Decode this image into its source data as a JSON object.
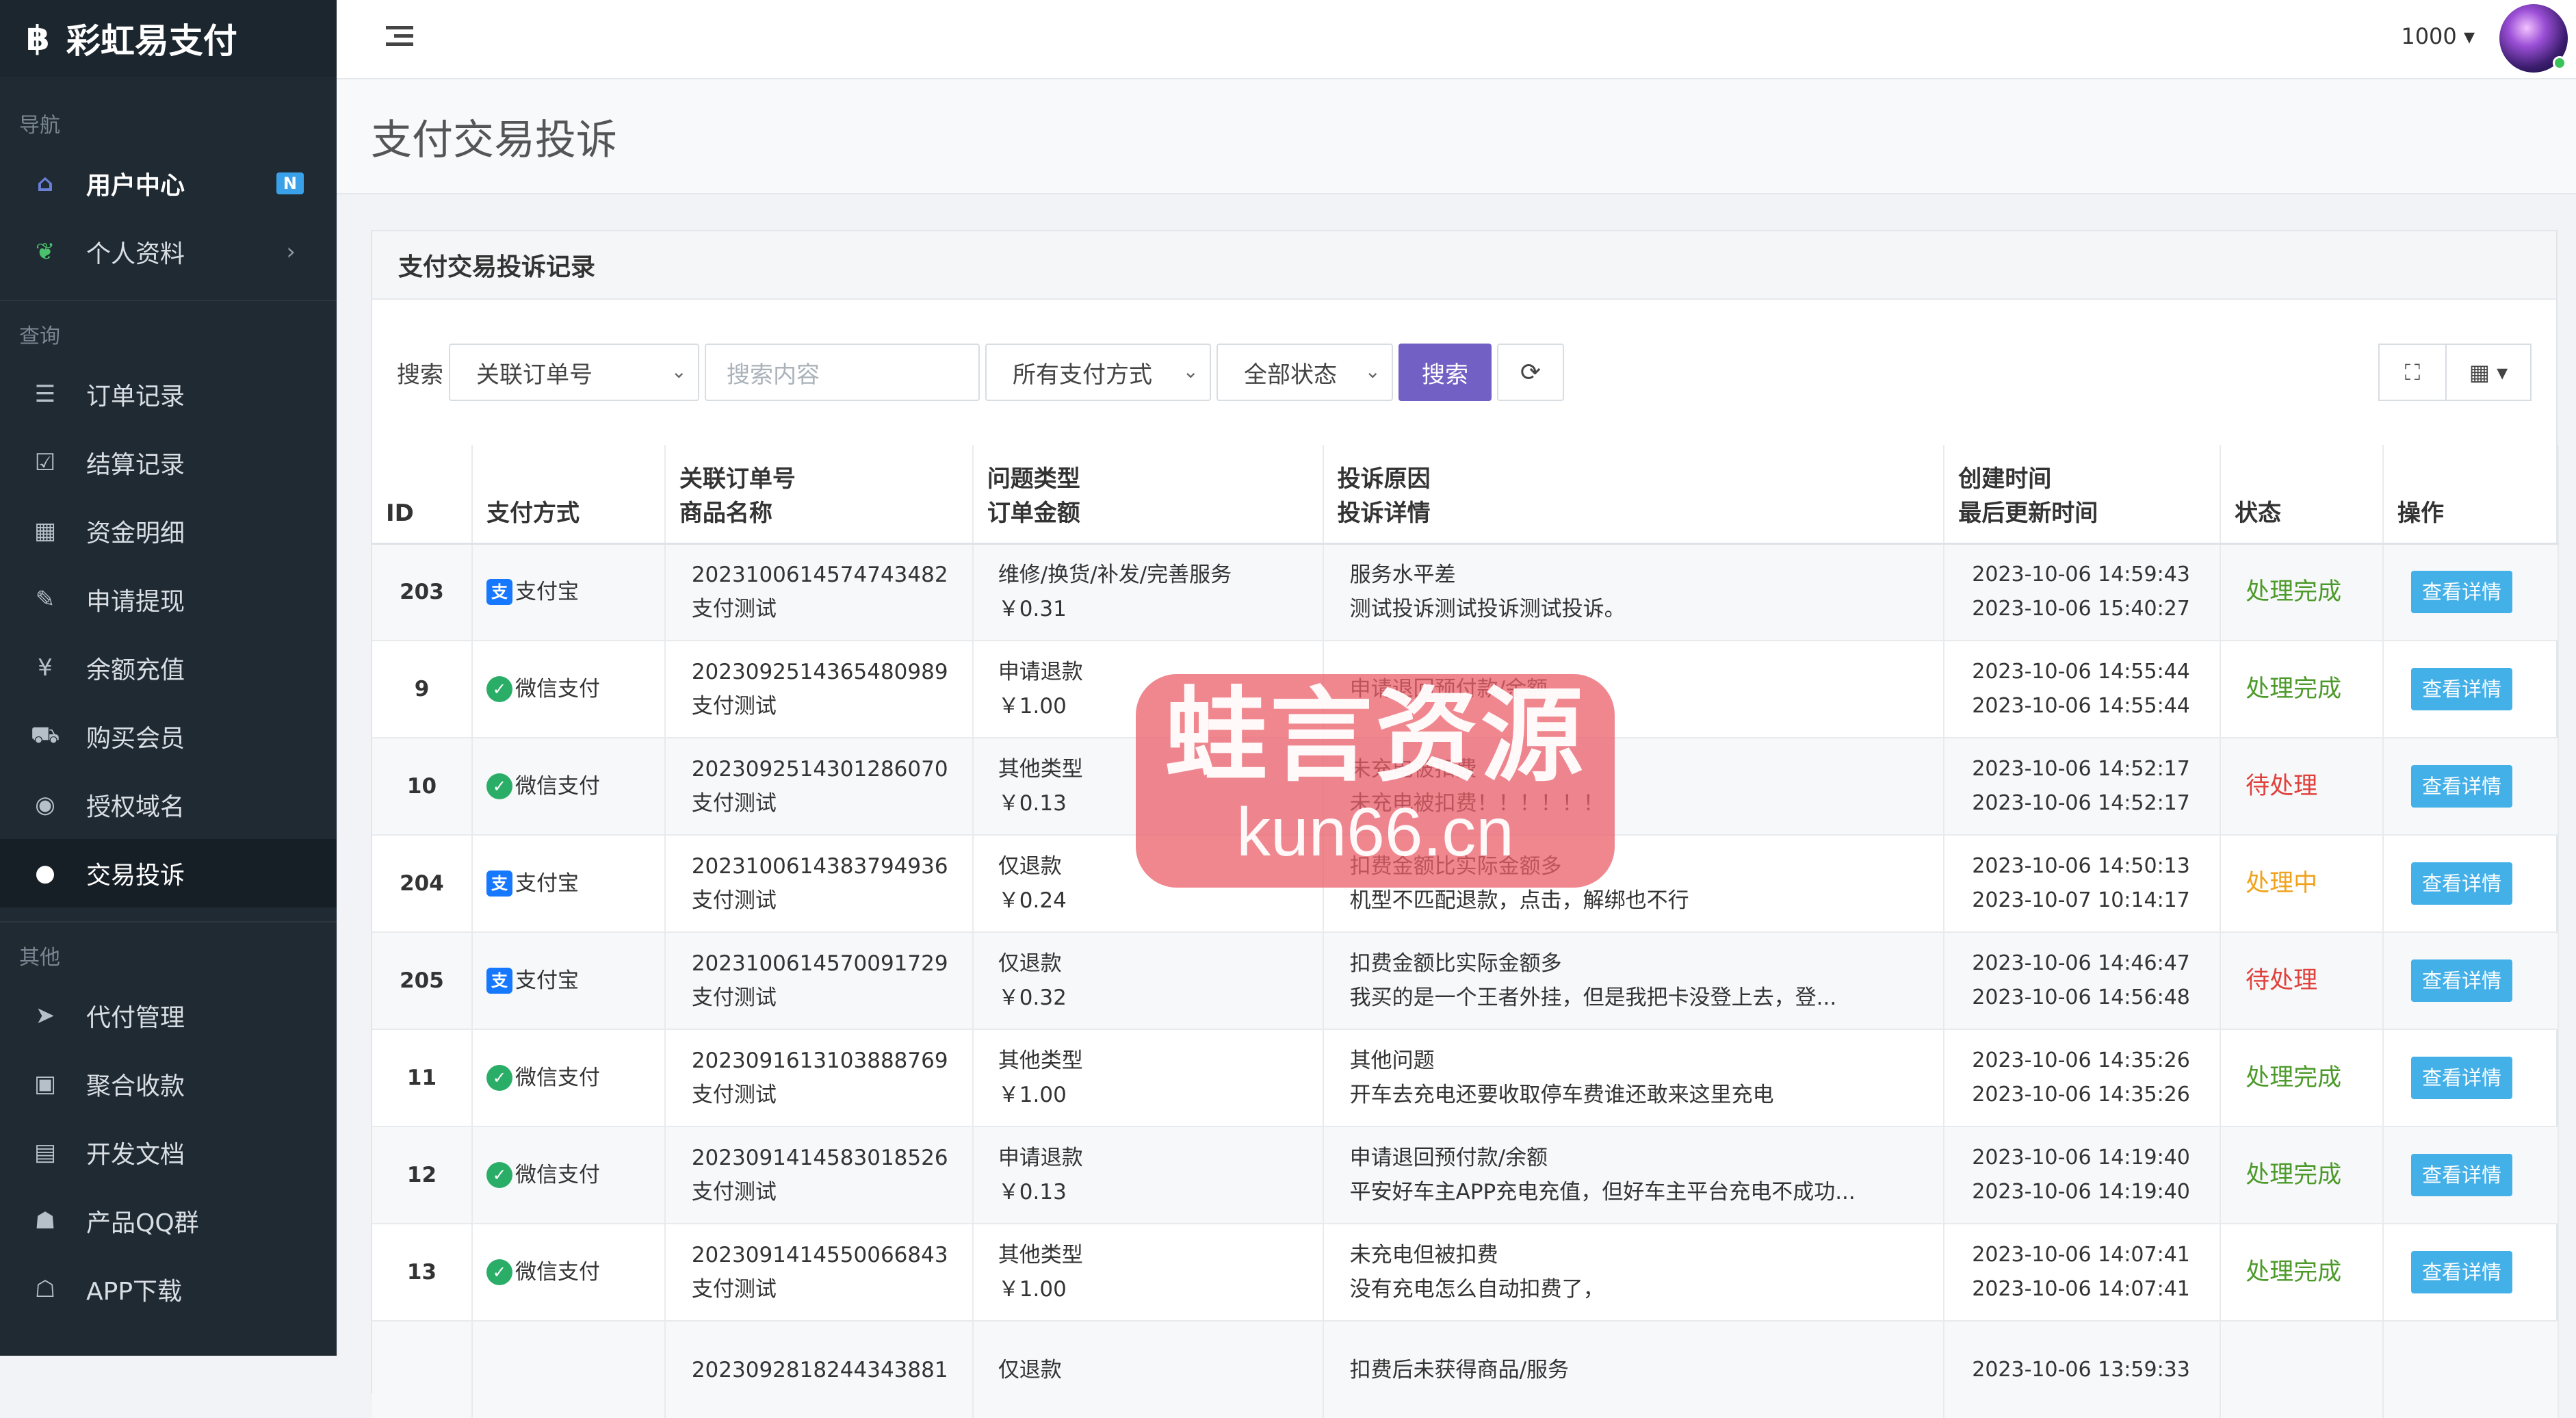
{
  "brand": {
    "logo_glyph": "฿",
    "name": "彩虹易支付"
  },
  "sidebar": {
    "sections": [
      {
        "title": "导航",
        "items": [
          {
            "label": "用户中心",
            "icon": "home-icon",
            "badge": "N"
          },
          {
            "label": "个人资料",
            "icon": "leaf-icon",
            "caret": "›"
          }
        ]
      },
      {
        "title": "查询",
        "items": [
          {
            "label": "订单记录",
            "icon": "list-icon"
          },
          {
            "label": "结算记录",
            "icon": "check-square-icon"
          },
          {
            "label": "资金明细",
            "icon": "calendar-icon"
          },
          {
            "label": "申请提现",
            "icon": "edit-icon"
          },
          {
            "label": "余额充值",
            "icon": "yen-icon"
          },
          {
            "label": "购买会员",
            "icon": "cart-icon"
          },
          {
            "label": "授权域名",
            "icon": "globe-icon"
          },
          {
            "label": "交易投诉",
            "icon": "chat-icon"
          }
        ]
      },
      {
        "title": "其他",
        "items": [
          {
            "label": "代付管理",
            "icon": "send-icon"
          },
          {
            "label": "聚合收款",
            "icon": "qrcode-icon"
          },
          {
            "label": "开发文档",
            "icon": "document-icon"
          },
          {
            "label": "产品QQ群",
            "icon": "qq-icon"
          },
          {
            "label": "APP下载",
            "icon": "android-icon"
          }
        ]
      }
    ]
  },
  "topbar": {
    "user": "1000",
    "caret": "▾"
  },
  "page": {
    "title": "支付交易投诉"
  },
  "panel": {
    "title": "支付交易投诉记录"
  },
  "search": {
    "label": "搜索",
    "field_select": "关联订单号",
    "placeholder": "搜索内容",
    "pay_select": "所有支付方式",
    "status_select": "全部状态",
    "search_button": "搜索",
    "refresh_glyph": "⟳",
    "fullscreen_glyph": "⛶",
    "columns_glyph": "▦ ▾"
  },
  "table": {
    "headers": {
      "id": "ID",
      "paytype": "支付方式",
      "order_1": "关联订单号",
      "order_2": "商品名称",
      "type_1": "问题类型",
      "type_2": "订单金额",
      "reason_1": "投诉原因",
      "reason_2": "投诉详情",
      "time_1": "创建时间",
      "time_2": "最后更新时间",
      "status": "状态",
      "action": "操作"
    },
    "rows": [
      {
        "id": "203",
        "pay": "支付宝",
        "pay_type": "alipay",
        "order": "2023100614574743482",
        "product": "支付测试",
        "type": "维修/换货/补发/完善服务",
        "amount": "￥0.31",
        "reason": "服务水平差",
        "detail": "测试投诉测试投诉测试投诉。",
        "created": "2023-10-06 14:59:43",
        "updated": "2023-10-06 15:40:27",
        "status": "处理完成",
        "status_color": "#4c9a2a",
        "action": "查看详情"
      },
      {
        "id": "9",
        "pay": "微信支付",
        "pay_type": "wechat",
        "order": "2023092514365480989",
        "product": "支付测试",
        "type": "申请退款",
        "amount": "￥1.00",
        "reason": "申请退回预付款/余额",
        "detail": "",
        "created": "2023-10-06 14:55:44",
        "updated": "2023-10-06 14:55:44",
        "status": "处理完成",
        "status_color": "#4c9a2a",
        "action": "查看详情"
      },
      {
        "id": "10",
        "pay": "微信支付",
        "pay_type": "wechat",
        "order": "2023092514301286070",
        "product": "支付测试",
        "type": "其他类型",
        "amount": "￥0.13",
        "reason": "未充电被扣费",
        "detail": "未充电被扣费！！！！！！",
        "created": "2023-10-06 14:52:17",
        "updated": "2023-10-06 14:52:17",
        "status": "待处理",
        "status_color": "#e0413c",
        "action": "查看详情"
      },
      {
        "id": "204",
        "pay": "支付宝",
        "pay_type": "alipay",
        "order": "2023100614383794936",
        "product": "支付测试",
        "type": "仅退款",
        "amount": "￥0.24",
        "reason": "扣费金额比实际金额多",
        "detail": "机型不匹配退款，点击，解绑也不行",
        "created": "2023-10-06 14:50:13",
        "updated": "2023-10-07 10:14:17",
        "status": "处理中",
        "status_color": "#f0a21a",
        "action": "查看详情"
      },
      {
        "id": "205",
        "pay": "支付宝",
        "pay_type": "alipay",
        "order": "2023100614570091729",
        "product": "支付测试",
        "type": "仅退款",
        "amount": "￥0.32",
        "reason": "扣费金额比实际金额多",
        "detail": "我买的是一个王者外挂，但是我把卡没登上去，登...",
        "created": "2023-10-06 14:46:47",
        "updated": "2023-10-06 14:56:48",
        "status": "待处理",
        "status_color": "#e0413c",
        "action": "查看详情"
      },
      {
        "id": "11",
        "pay": "微信支付",
        "pay_type": "wechat",
        "order": "2023091613103888769",
        "product": "支付测试",
        "type": "其他类型",
        "amount": "￥1.00",
        "reason": "其他问题",
        "detail": "开车去充电还要收取停车费谁还敢来这里充电",
        "created": "2023-10-06 14:35:26",
        "updated": "2023-10-06 14:35:26",
        "status": "处理完成",
        "status_color": "#4c9a2a",
        "action": "查看详情"
      },
      {
        "id": "12",
        "pay": "微信支付",
        "pay_type": "wechat",
        "order": "2023091414583018526",
        "product": "支付测试",
        "type": "申请退款",
        "amount": "￥0.13",
        "reason": "申请退回预付款/余额",
        "detail": "平安好车主APP充电充值，但好车主平台充电不成功...",
        "created": "2023-10-06 14:19:40",
        "updated": "2023-10-06 14:19:40",
        "status": "处理完成",
        "status_color": "#4c9a2a",
        "action": "查看详情"
      },
      {
        "id": "13",
        "pay": "微信支付",
        "pay_type": "wechat",
        "order": "2023091414550066843",
        "product": "支付测试",
        "type": "其他类型",
        "amount": "￥1.00",
        "reason": "未充电但被扣费",
        "detail": "没有充电怎么自动扣费了，",
        "created": "2023-10-06 14:07:41",
        "updated": "2023-10-06 14:07:41",
        "status": "处理完成",
        "status_color": "#4c9a2a",
        "action": "查看详情"
      },
      {
        "id": "",
        "pay": "",
        "pay_type": "",
        "order": "2023092818244343881",
        "product": "",
        "type": "仅退款",
        "amount": "",
        "reason": "扣费后未获得商品/服务",
        "detail": "",
        "created": "2023-10-06 13:59:33",
        "updated": "",
        "status": "",
        "status_color": "#333333",
        "action": ""
      }
    ]
  },
  "watermark": {
    "line1": "蛙言资源",
    "line2": "kun66.cn"
  }
}
